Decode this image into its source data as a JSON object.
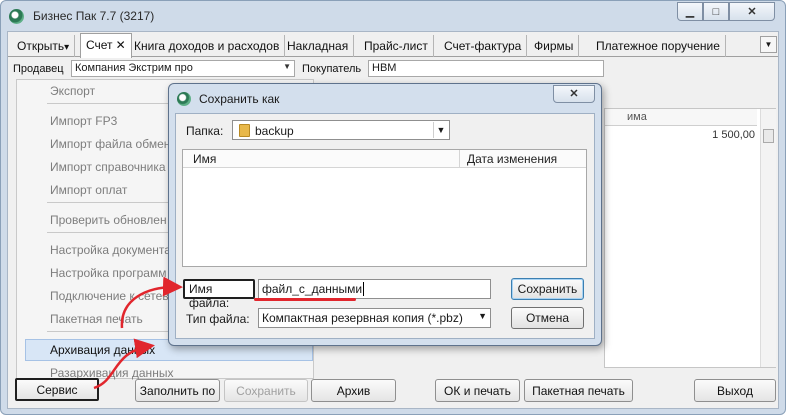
{
  "window": {
    "title": "Бизнес Пак 7.7 (3217)",
    "minimize": "▁",
    "maximize": "□",
    "close": "✕"
  },
  "tabs": [
    {
      "label": "Открыть",
      "arrow": "▾"
    },
    {
      "label": "Счет",
      "close": "✕"
    },
    {
      "label": "Книга доходов и расходов"
    },
    {
      "label": "Накладная"
    },
    {
      "label": "Прайс-лист"
    },
    {
      "label": "Счет-фактура"
    },
    {
      "label": "Фирмы"
    },
    {
      "label": "Платежное поручение"
    }
  ],
  "tab_scroll_arrow": "▼",
  "form": {
    "seller_label": "Продавец",
    "seller_value": "Компания Экстрим про",
    "buyer_label": "Покупатель",
    "buyer_value": "HBM",
    "combo_arrow": "▼"
  },
  "menu": {
    "items": [
      "Экспорт",
      "Импорт FP3",
      "Импорт файла обмен",
      "Импорт справочника",
      "Импорт оплат",
      "Проверить обновлен",
      "Настройка документа",
      "Настройка программ",
      "Подключение к сетев",
      "Пакетная печать",
      "Архивация данных",
      "Разархивация данных"
    ]
  },
  "grid": {
    "header_fragment": "има",
    "value": "1 500,00"
  },
  "buttons": {
    "service": "Сервис",
    "fill": "Заполнить по",
    "save": "Сохранить",
    "archive": "Архив",
    "ok_print": "ОК и печать",
    "batch_print": "Пакетная печать",
    "exit": "Выход"
  },
  "dialog": {
    "title": "Сохранить как",
    "close": "✕",
    "folder_label": "Папка:",
    "folder_value": "backup",
    "folder_arrow": "▼",
    "col_name": "Имя",
    "col_date": "Дата изменения",
    "filename_label": "Имя файла:",
    "filename_value": "файл_с_данными",
    "filetype_label": "Тип файла:",
    "filetype_value": "Компактная резервная копия (*.pbz)",
    "filetype_arrow": "▼",
    "save_button": "Сохранить",
    "cancel_button": "Отмена"
  },
  "colors": {
    "annotation_red": "#e1262d",
    "highlight_blue": "#d8e6f6",
    "frame_blue": "#cfdbe9"
  }
}
